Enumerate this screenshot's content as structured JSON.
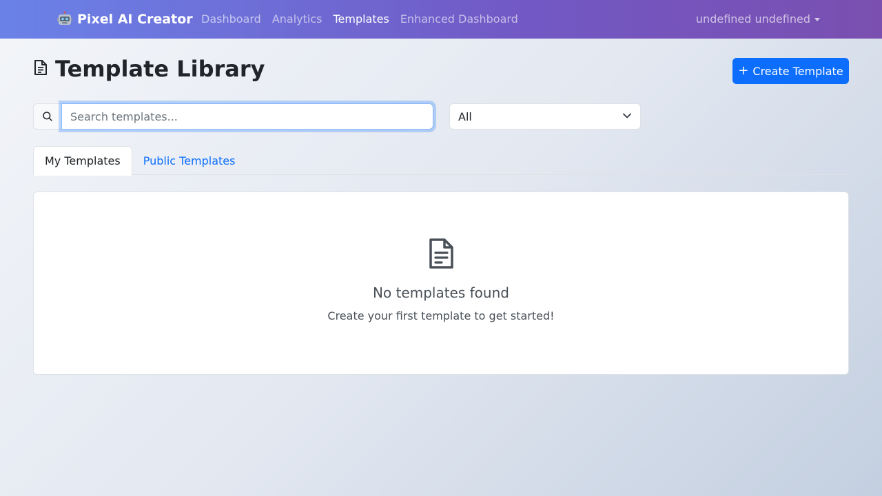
{
  "navbar": {
    "brand": "Pixel AI Creator",
    "brand_icon": "robot-icon",
    "links": [
      {
        "label": "Dashboard",
        "active": false
      },
      {
        "label": "Analytics",
        "active": false
      },
      {
        "label": "Templates",
        "active": true
      },
      {
        "label": "Enhanced Dashboard",
        "active": false
      }
    ],
    "user": "undefined undefined"
  },
  "header": {
    "title": "Template Library",
    "title_icon": "document-icon",
    "create_button": "Create Template",
    "create_icon": "plus-icon"
  },
  "search": {
    "placeholder": "Search templates...",
    "value": "",
    "icon": "search-icon"
  },
  "filter": {
    "selected": "All"
  },
  "tabs": [
    {
      "label": "My Templates",
      "active": true
    },
    {
      "label": "Public Templates",
      "active": false
    }
  ],
  "empty_state": {
    "icon": "document-icon",
    "title": "No templates found",
    "subtitle": "Create your first template to get started!"
  },
  "colors": {
    "primary": "#0d6efd",
    "nav_start": "#6a82e8",
    "nav_end": "#7a4fb0"
  }
}
